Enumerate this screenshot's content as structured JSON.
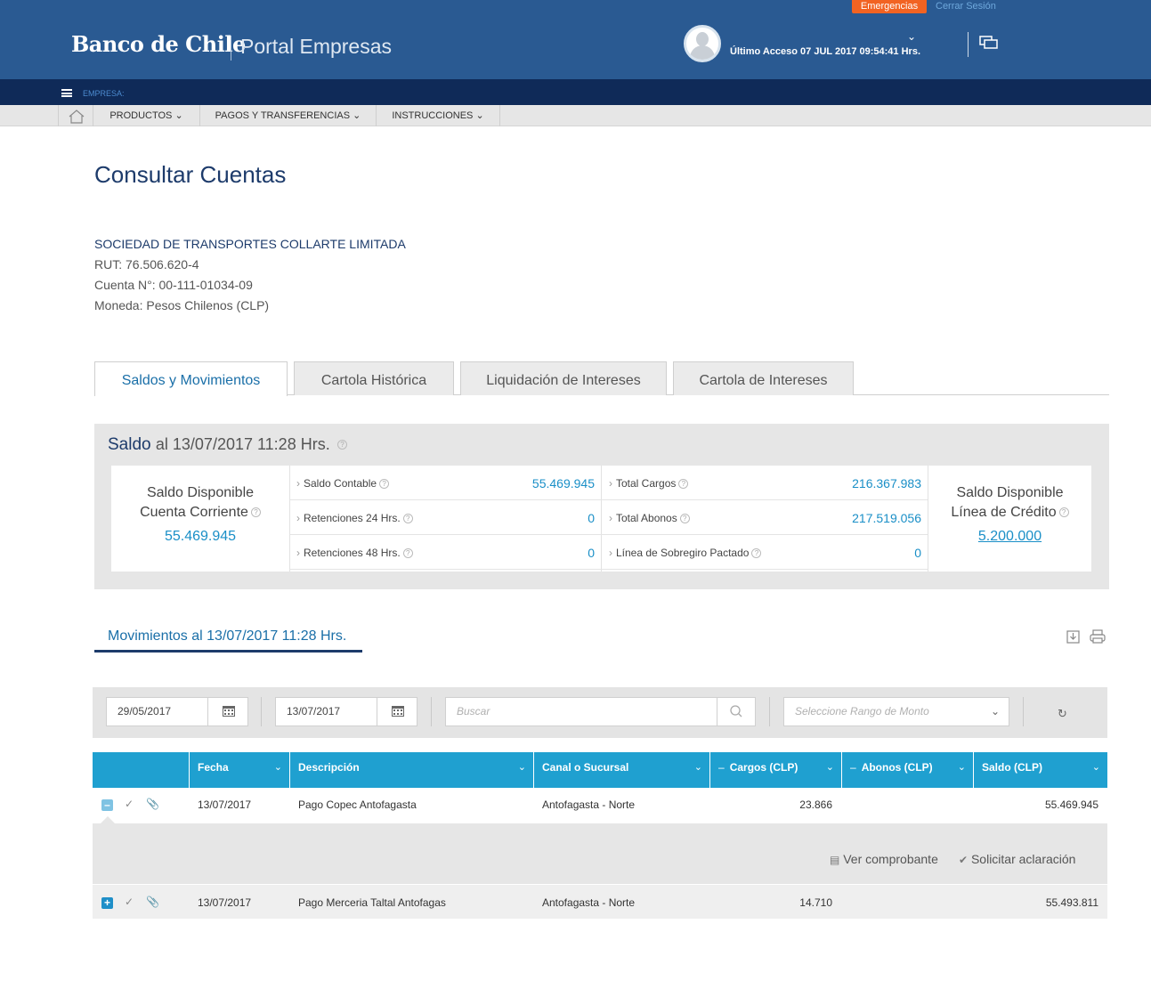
{
  "header": {
    "emergencias": "Emergencias",
    "cerrar_sesion": "Cerrar Sesión",
    "brand": "Banco de Chile",
    "portal": "Portal Empresas",
    "last_access": "Último Acceso 07 JUL 2017 09:54:41 Hrs.",
    "colors": {
      "primary": "#2a5a92",
      "dark": "#0f2a58",
      "accent": "#f26322"
    }
  },
  "empresa_bar": {
    "label": "EMPRESA:"
  },
  "nav": {
    "items": [
      {
        "label": "PRODUCTOS"
      },
      {
        "label": "PAGOS Y TRANSFERENCIAS"
      },
      {
        "label": "INSTRUCCIONES"
      }
    ]
  },
  "page": {
    "title": "Consultar Cuentas",
    "company": "SOCIEDAD DE TRANSPORTES COLLARTE LIMITADA",
    "rut": "RUT: 76.506.620-4",
    "cuenta": "Cuenta N°: 00-111-01034-09",
    "moneda": "Moneda: Pesos Chilenos (CLP)"
  },
  "tabs": [
    {
      "label": "Saldos y Movimientos",
      "active": true
    },
    {
      "label": "Cartola Histórica"
    },
    {
      "label": "Liquidación de Intereses"
    },
    {
      "label": "Cartola de Intereses"
    }
  ],
  "saldo": {
    "title": "Saldo",
    "subtitle": "al 13/07/2017 11:28 Hrs.",
    "disponible_cc": {
      "line1": "Saldo Disponible",
      "line2": "Cuenta Corriente",
      "value": "55.469.945"
    },
    "disponible_lc": {
      "line1": "Saldo Disponible",
      "line2": "Línea de Crédito",
      "value": "5.200.000"
    },
    "col1": [
      {
        "label": "Saldo Contable",
        "value": "55.469.945"
      },
      {
        "label": "Retenciones 24 Hrs.",
        "value": "0"
      },
      {
        "label": "Retenciones 48 Hrs.",
        "value": "0"
      }
    ],
    "col2": [
      {
        "label": "Total Cargos",
        "value": "216.367.983"
      },
      {
        "label": "Total Abonos",
        "value": "217.519.056"
      },
      {
        "label": "Línea de Sobregiro Pactado",
        "value": "0"
      }
    ]
  },
  "movimientos": {
    "title": "Movimientos al 13/07/2017 11:28 Hrs.",
    "filters": {
      "date_from": "29/05/2017",
      "date_to": "13/07/2017",
      "search_placeholder": "Buscar",
      "range_placeholder": "Seleccione Rango de Monto"
    },
    "columns": [
      "Fecha",
      "Descripción",
      "Canal o Sucursal",
      "Cargos (CLP)",
      "Abonos (CLP)",
      "Saldo (CLP)"
    ],
    "rows": [
      {
        "fecha": "13/07/2017",
        "descripcion": "Pago Copec Antofagasta",
        "canal": "Antofagasta - Norte",
        "cargos": "23.866",
        "abonos": "",
        "saldo": "55.469.945",
        "expanded": true
      },
      {
        "fecha": "13/07/2017",
        "descripcion": "Pago Merceria Taltal Antofagas",
        "canal": "Antofagasta - Norte",
        "cargos": "14.710",
        "abonos": "",
        "saldo": "55.493.811",
        "expanded": false
      }
    ],
    "actions": {
      "ver": "Ver comprobante",
      "solicitar": "Solicitar aclaración"
    }
  }
}
